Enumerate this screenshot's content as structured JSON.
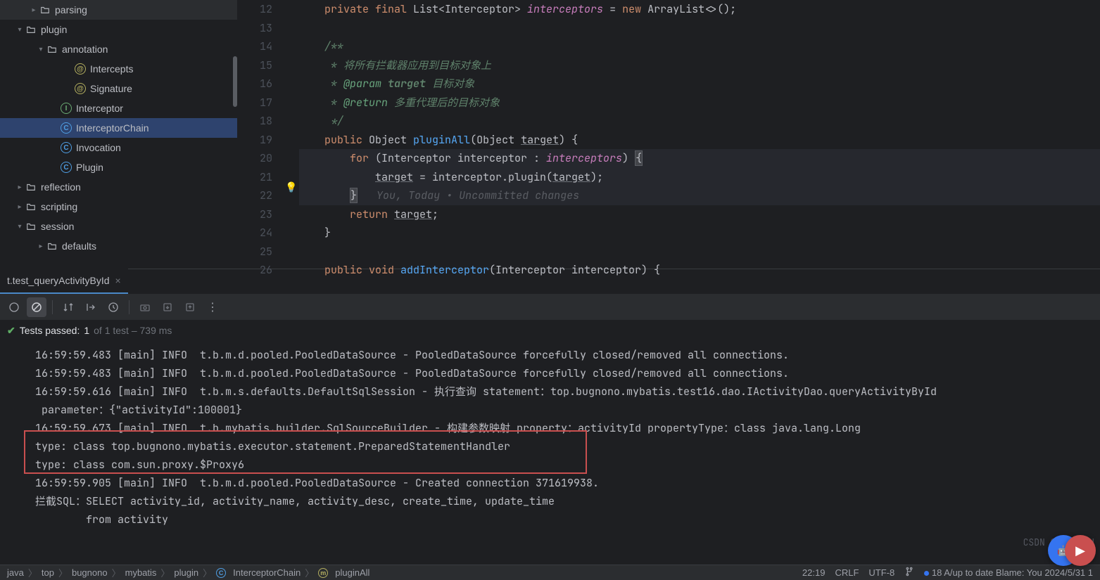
{
  "tree": {
    "items": [
      {
        "indent": 40,
        "chev": "closed",
        "icon": "folder",
        "label": "parsing"
      },
      {
        "indent": 20,
        "chev": "open",
        "icon": "folder",
        "label": "plugin"
      },
      {
        "indent": 50,
        "chev": "open",
        "icon": "folder",
        "label": "annotation"
      },
      {
        "indent": 90,
        "chev": "",
        "icon": "a",
        "label": "Intercepts"
      },
      {
        "indent": 90,
        "chev": "",
        "icon": "a",
        "label": "Signature"
      },
      {
        "indent": 70,
        "chev": "",
        "icon": "i",
        "label": "Interceptor"
      },
      {
        "indent": 70,
        "chev": "",
        "icon": "c",
        "label": "InterceptorChain",
        "selected": true
      },
      {
        "indent": 70,
        "chev": "",
        "icon": "c",
        "label": "Invocation"
      },
      {
        "indent": 70,
        "chev": "",
        "icon": "c",
        "label": "Plugin"
      },
      {
        "indent": 20,
        "chev": "closed",
        "icon": "folder",
        "label": "reflection"
      },
      {
        "indent": 20,
        "chev": "closed",
        "icon": "folder",
        "label": "scripting"
      },
      {
        "indent": 20,
        "chev": "open",
        "icon": "folder",
        "label": "session"
      },
      {
        "indent": 50,
        "chev": "closed",
        "icon": "folder",
        "label": "defaults"
      }
    ]
  },
  "editor": {
    "first_line": 12,
    "lines": [
      {
        "n": 12,
        "seg": [
          {
            "t": "    ",
            "c": ""
          },
          {
            "t": "private final ",
            "c": "kw"
          },
          {
            "t": "List<Interceptor> ",
            "c": "ty"
          },
          {
            "t": "interceptors",
            "c": "pr"
          },
          {
            "t": " = ",
            "c": ""
          },
          {
            "t": "new ",
            "c": "kw"
          },
          {
            "t": "ArrayList<>();",
            "c": "ty"
          }
        ]
      },
      {
        "n": 13,
        "seg": []
      },
      {
        "n": 14,
        "seg": [
          {
            "t": "    ",
            "c": ""
          },
          {
            "t": "/**",
            "c": "cm"
          }
        ]
      },
      {
        "n": 15,
        "seg": [
          {
            "t": "    ",
            "c": ""
          },
          {
            "t": " * 将所有拦截器应用到目标对象上",
            "c": "cm"
          }
        ]
      },
      {
        "n": 16,
        "seg": [
          {
            "t": "    ",
            "c": ""
          },
          {
            "t": " * ",
            "c": "cm"
          },
          {
            "t": "@param",
            "c": "tag"
          },
          {
            "t": " target",
            "c": "cm",
            "b": true
          },
          {
            "t": " 目标对象",
            "c": "cm"
          }
        ]
      },
      {
        "n": 17,
        "seg": [
          {
            "t": "    ",
            "c": ""
          },
          {
            "t": " * ",
            "c": "cm"
          },
          {
            "t": "@return",
            "c": "tag"
          },
          {
            "t": " 多重代理后的目标对象",
            "c": "cm"
          }
        ]
      },
      {
        "n": 18,
        "seg": [
          {
            "t": "    ",
            "c": ""
          },
          {
            "t": " */",
            "c": "cm"
          }
        ]
      },
      {
        "n": 19,
        "seg": [
          {
            "t": "    ",
            "c": ""
          },
          {
            "t": "public ",
            "c": "kw"
          },
          {
            "t": "Object ",
            "c": "ty"
          },
          {
            "t": "pluginAll",
            "c": "mn"
          },
          {
            "t": "(Object ",
            "c": ""
          },
          {
            "t": "target",
            "c": "und"
          },
          {
            "t": ") {",
            "c": ""
          }
        ]
      },
      {
        "n": 20,
        "hl": true,
        "seg": [
          {
            "t": "        ",
            "c": ""
          },
          {
            "t": "for ",
            "c": "kw"
          },
          {
            "t": "(Interceptor interceptor : ",
            "c": ""
          },
          {
            "t": "interceptors",
            "c": "pr"
          },
          {
            "t": ") ",
            "c": ""
          },
          {
            "t": "{",
            "c": "brace-hl"
          }
        ]
      },
      {
        "n": 21,
        "hl": true,
        "seg": [
          {
            "t": "            ",
            "c": ""
          },
          {
            "t": "target",
            "c": "und"
          },
          {
            "t": " = interceptor.plugin(",
            "c": ""
          },
          {
            "t": "target",
            "c": "und"
          },
          {
            "t": ");",
            "c": ""
          }
        ]
      },
      {
        "n": 22,
        "hl": true,
        "bulb": true,
        "seg": [
          {
            "t": "        ",
            "c": ""
          },
          {
            "t": "}",
            "c": "brace-hl"
          },
          {
            "t": "   ",
            "c": ""
          },
          {
            "t": "You",
            "c": "blame you"
          },
          {
            "t": ", ",
            "c": "blame"
          },
          {
            "t": "Today",
            "c": "blame"
          },
          {
            "t": " • ",
            "c": "blame"
          },
          {
            "t": "Uncommitted changes",
            "c": "blame"
          }
        ]
      },
      {
        "n": 23,
        "seg": [
          {
            "t": "        ",
            "c": ""
          },
          {
            "t": "return ",
            "c": "kw"
          },
          {
            "t": "target",
            "c": "und"
          },
          {
            "t": ";",
            "c": ""
          }
        ]
      },
      {
        "n": 24,
        "seg": [
          {
            "t": "    }",
            "c": ""
          }
        ]
      },
      {
        "n": 25,
        "seg": []
      },
      {
        "n": 26,
        "seg": [
          {
            "t": "    ",
            "c": ""
          },
          {
            "t": "public void ",
            "c": "kw"
          },
          {
            "t": "addInterceptor",
            "c": "mn"
          },
          {
            "t": "(Interceptor interceptor) {",
            "c": ""
          }
        ]
      }
    ]
  },
  "tab": {
    "label": "t.test_queryActivityById"
  },
  "tests": {
    "passed_label": "Tests passed:",
    "passed": "1",
    "of": "of 1 test – 739 ms"
  },
  "console": [
    "16:59:59.483 [main] INFO  t.b.m.d.pooled.PooledDataSource - PooledDataSource forcefully closed/removed all connections.",
    "16:59:59.483 [main] INFO  t.b.m.d.pooled.PooledDataSource - PooledDataSource forcefully closed/removed all connections.",
    "16:59:59.616 [main] INFO  t.b.m.s.defaults.DefaultSqlSession - 执行查询 statement：top.bugnono.mybatis.test16.dao.IActivityDao.queryActivityById",
    " parameter：{\"activityId\":100001}",
    "16:59:59.673 [main] INFO  t.b.mybatis.builder.SqlSourceBuilder - 构建参数映射 property：activityId propertyType：class java.lang.Long",
    "type: class top.bugnono.mybatis.executor.statement.PreparedStatementHandler",
    "type: class com.sun.proxy.$Proxy6",
    "16:59:59.905 [main] INFO  t.b.m.d.pooled.PooledDataSource - Created connection 371619938.",
    "拦截SQL：SELECT activity_id, activity_name, activity_desc, create_time, update_time",
    "        from activity"
  ],
  "watermark": "CSDN @Filwaod",
  "crumbs": [
    "java",
    "top",
    "bugnono",
    "mybatis",
    "plugin",
    "InterceptorChain",
    "pluginAll"
  ],
  "status": {
    "pos": "22:19",
    "sep": "CRLF",
    "enc": "UTF-8",
    "rest": "18 A/up to date   Blame: You 2024/5/31 1"
  }
}
